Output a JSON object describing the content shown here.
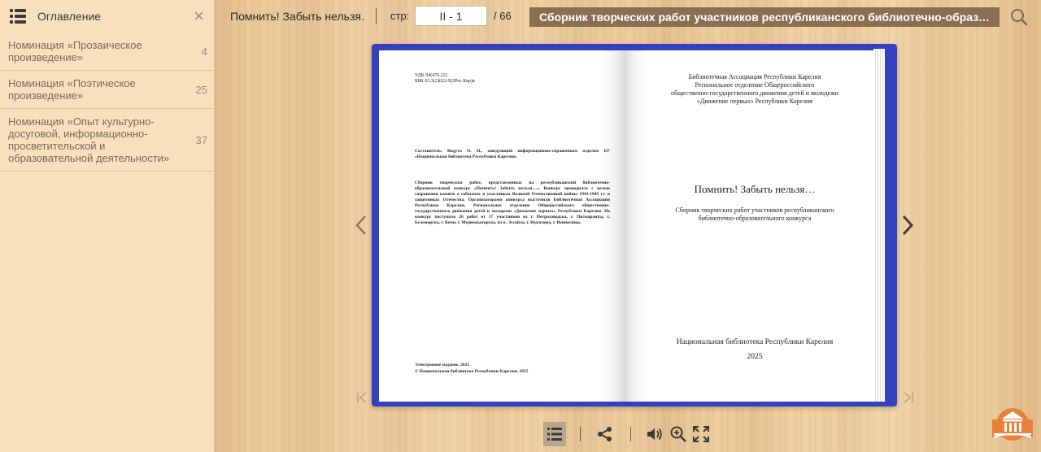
{
  "sidebar": {
    "title": "Оглавление",
    "close_label": "×",
    "items": [
      {
        "label": "Номинация «Прозаическое произведение»",
        "page": "4"
      },
      {
        "label": "Номинация «Поэтическое произведение»",
        "page": "25"
      },
      {
        "label": "Номинация «Опыт культурно-досуговой, информационно-просветительской и образовательной деятельности»",
        "page": "37"
      }
    ]
  },
  "toolbar": {
    "short_title": "Помнить! Забыть нельзя…",
    "page_label": "стр:",
    "page_value": "II - 1",
    "page_total": "/ 66",
    "long_title": "Сборник творческих работ участников республиканского библиотечно-образовательного конкурса"
  },
  "left_page": {
    "udk_line": "УДК 94(470.22)",
    "bbk_line": "ББК 63.3(2)622-9(2Рос.Кар)я",
    "compiler": "Составитель: Видута О. Н., заведующий информационно-справочным отделом БУ «Национальная библиотека Республики Карелия»",
    "abstract": "Сборник творческих работ, представленных на республиканский библиотечно-образовательный конкурс «Помнить! Забыть нельзя…». Конкурс проводился с целью сохранения памяти о событиях и участниках Великой Отечественной войны 1941-1945 гг. и защитниках Отечества. Организаторами конкурса выступили Библиотечная Ассоциация Республики Карелия, Региональное отделение Общероссийского общественно-государственного движения детей и молодежи «Движение первых» Республики Карелия. На конкурс поступило 26 работ от 17 участников из г. Петрозаводска, г. Питкяранты, г. Беломорска, г. Кеми, г. Медвежьегорска, из п. Эссойла, г. Ведлозера, г. Вешкелица.",
    "edition": "Электронное издание, 2025",
    "copyright": "© Национальная библиотека Республики Карелия, 2025"
  },
  "right_page": {
    "publishers": [
      "Библиотечная Ассоциация Республики Карелия",
      "Региональное отделение Общероссийского",
      "общественно-государственного движения детей и молодежи",
      "«Движение первых» Республики Карелия"
    ],
    "title": "Помнить! Забыть нельзя…",
    "subtitle_1": "Сборник творческих работ участников республиканского",
    "subtitle_2": "библиотечно-образовательного конкурса",
    "publisher": "Национальная библиотека Республики Карелия",
    "year": "2025"
  },
  "colors": {
    "book_cover": "#3440c0",
    "sidebar_bg": "#f8e0bd",
    "title_bar": "#8a6e52"
  },
  "icons": [
    "menu-icon",
    "close-icon",
    "search-icon",
    "prev-arrow-icon",
    "next-arrow-icon",
    "first-page-icon",
    "last-page-icon",
    "toc-icon",
    "share-icon",
    "sound-icon",
    "zoom-icon",
    "fullscreen-icon",
    "library-logo"
  ]
}
